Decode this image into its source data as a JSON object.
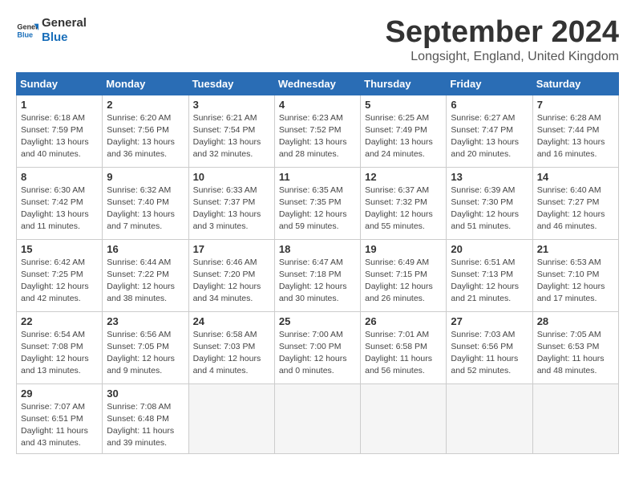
{
  "header": {
    "logo_line1": "General",
    "logo_line2": "Blue",
    "title": "September 2024",
    "subtitle": "Longsight, England, United Kingdom"
  },
  "days_of_week": [
    "Sunday",
    "Monday",
    "Tuesday",
    "Wednesday",
    "Thursday",
    "Friday",
    "Saturday"
  ],
  "weeks": [
    [
      {
        "day": "1",
        "detail": "Sunrise: 6:18 AM\nSunset: 7:59 PM\nDaylight: 13 hours\nand 40 minutes."
      },
      {
        "day": "2",
        "detail": "Sunrise: 6:20 AM\nSunset: 7:56 PM\nDaylight: 13 hours\nand 36 minutes."
      },
      {
        "day": "3",
        "detail": "Sunrise: 6:21 AM\nSunset: 7:54 PM\nDaylight: 13 hours\nand 32 minutes."
      },
      {
        "day": "4",
        "detail": "Sunrise: 6:23 AM\nSunset: 7:52 PM\nDaylight: 13 hours\nand 28 minutes."
      },
      {
        "day": "5",
        "detail": "Sunrise: 6:25 AM\nSunset: 7:49 PM\nDaylight: 13 hours\nand 24 minutes."
      },
      {
        "day": "6",
        "detail": "Sunrise: 6:27 AM\nSunset: 7:47 PM\nDaylight: 13 hours\nand 20 minutes."
      },
      {
        "day": "7",
        "detail": "Sunrise: 6:28 AM\nSunset: 7:44 PM\nDaylight: 13 hours\nand 16 minutes."
      }
    ],
    [
      {
        "day": "8",
        "detail": "Sunrise: 6:30 AM\nSunset: 7:42 PM\nDaylight: 13 hours\nand 11 minutes."
      },
      {
        "day": "9",
        "detail": "Sunrise: 6:32 AM\nSunset: 7:40 PM\nDaylight: 13 hours\nand 7 minutes."
      },
      {
        "day": "10",
        "detail": "Sunrise: 6:33 AM\nSunset: 7:37 PM\nDaylight: 13 hours\nand 3 minutes."
      },
      {
        "day": "11",
        "detail": "Sunrise: 6:35 AM\nSunset: 7:35 PM\nDaylight: 12 hours\nand 59 minutes."
      },
      {
        "day": "12",
        "detail": "Sunrise: 6:37 AM\nSunset: 7:32 PM\nDaylight: 12 hours\nand 55 minutes."
      },
      {
        "day": "13",
        "detail": "Sunrise: 6:39 AM\nSunset: 7:30 PM\nDaylight: 12 hours\nand 51 minutes."
      },
      {
        "day": "14",
        "detail": "Sunrise: 6:40 AM\nSunset: 7:27 PM\nDaylight: 12 hours\nand 46 minutes."
      }
    ],
    [
      {
        "day": "15",
        "detail": "Sunrise: 6:42 AM\nSunset: 7:25 PM\nDaylight: 12 hours\nand 42 minutes."
      },
      {
        "day": "16",
        "detail": "Sunrise: 6:44 AM\nSunset: 7:22 PM\nDaylight: 12 hours\nand 38 minutes."
      },
      {
        "day": "17",
        "detail": "Sunrise: 6:46 AM\nSunset: 7:20 PM\nDaylight: 12 hours\nand 34 minutes."
      },
      {
        "day": "18",
        "detail": "Sunrise: 6:47 AM\nSunset: 7:18 PM\nDaylight: 12 hours\nand 30 minutes."
      },
      {
        "day": "19",
        "detail": "Sunrise: 6:49 AM\nSunset: 7:15 PM\nDaylight: 12 hours\nand 26 minutes."
      },
      {
        "day": "20",
        "detail": "Sunrise: 6:51 AM\nSunset: 7:13 PM\nDaylight: 12 hours\nand 21 minutes."
      },
      {
        "day": "21",
        "detail": "Sunrise: 6:53 AM\nSunset: 7:10 PM\nDaylight: 12 hours\nand 17 minutes."
      }
    ],
    [
      {
        "day": "22",
        "detail": "Sunrise: 6:54 AM\nSunset: 7:08 PM\nDaylight: 12 hours\nand 13 minutes."
      },
      {
        "day": "23",
        "detail": "Sunrise: 6:56 AM\nSunset: 7:05 PM\nDaylight: 12 hours\nand 9 minutes."
      },
      {
        "day": "24",
        "detail": "Sunrise: 6:58 AM\nSunset: 7:03 PM\nDaylight: 12 hours\nand 4 minutes."
      },
      {
        "day": "25",
        "detail": "Sunrise: 7:00 AM\nSunset: 7:00 PM\nDaylight: 12 hours\nand 0 minutes."
      },
      {
        "day": "26",
        "detail": "Sunrise: 7:01 AM\nSunset: 6:58 PM\nDaylight: 11 hours\nand 56 minutes."
      },
      {
        "day": "27",
        "detail": "Sunrise: 7:03 AM\nSunset: 6:56 PM\nDaylight: 11 hours\nand 52 minutes."
      },
      {
        "day": "28",
        "detail": "Sunrise: 7:05 AM\nSunset: 6:53 PM\nDaylight: 11 hours\nand 48 minutes."
      }
    ],
    [
      {
        "day": "29",
        "detail": "Sunrise: 7:07 AM\nSunset: 6:51 PM\nDaylight: 11 hours\nand 43 minutes."
      },
      {
        "day": "30",
        "detail": "Sunrise: 7:08 AM\nSunset: 6:48 PM\nDaylight: 11 hours\nand 39 minutes."
      },
      {
        "day": "",
        "detail": ""
      },
      {
        "day": "",
        "detail": ""
      },
      {
        "day": "",
        "detail": ""
      },
      {
        "day": "",
        "detail": ""
      },
      {
        "day": "",
        "detail": ""
      }
    ]
  ]
}
